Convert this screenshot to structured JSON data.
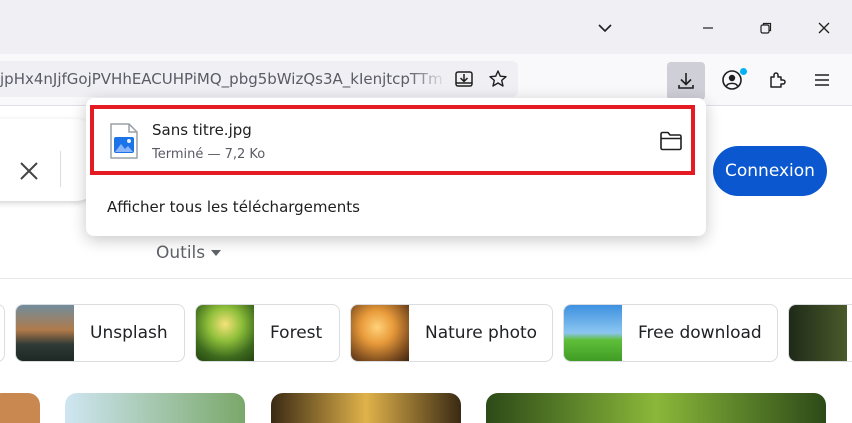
{
  "browser": {
    "url": "jpHx4nJjfGojPVHhEACUHPiMQ_pbg5bWizQs3A_kIenjtcpTTm"
  },
  "downloads_panel": {
    "file_name": "Sans titre.jpg",
    "file_status": "Terminé — 7,2 Ko",
    "show_all_label": "Afficher tous les téléchargements"
  },
  "page": {
    "connexion_label": "Connexion",
    "outils_label": "Outils",
    "chips": [
      {
        "label": "Unsplash"
      },
      {
        "label": "Forest"
      },
      {
        "label": "Nature photo"
      },
      {
        "label": "Free download"
      }
    ]
  },
  "icons": [
    "chevron-down-icon",
    "minimize-icon",
    "restore-icon",
    "close-icon",
    "save-page-icon",
    "star-icon",
    "download-icon",
    "account-icon",
    "extensions-icon",
    "menu-icon",
    "clear-search-icon",
    "folder-icon",
    "image-file-icon"
  ],
  "colors": {
    "accent": "#0b57d0",
    "highlight": "#e41b23",
    "notification": "#00b3f4"
  }
}
